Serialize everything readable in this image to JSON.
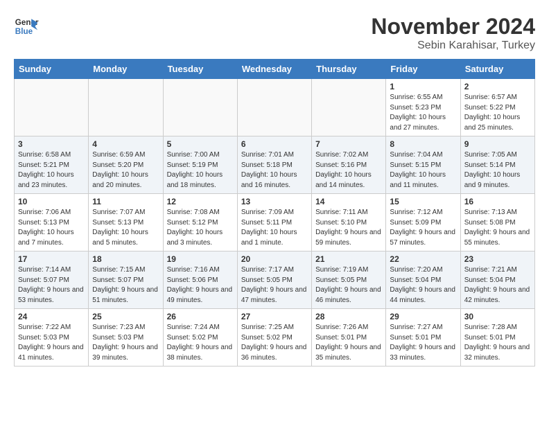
{
  "header": {
    "logo_text_general": "General",
    "logo_text_blue": "Blue",
    "month": "November 2024",
    "location": "Sebin Karahisar, Turkey"
  },
  "days_of_week": [
    "Sunday",
    "Monday",
    "Tuesday",
    "Wednesday",
    "Thursday",
    "Friday",
    "Saturday"
  ],
  "weeks": [
    [
      {
        "day": "",
        "info": ""
      },
      {
        "day": "",
        "info": ""
      },
      {
        "day": "",
        "info": ""
      },
      {
        "day": "",
        "info": ""
      },
      {
        "day": "",
        "info": ""
      },
      {
        "day": "1",
        "info": "Sunrise: 6:55 AM\nSunset: 5:23 PM\nDaylight: 10 hours and 27 minutes."
      },
      {
        "day": "2",
        "info": "Sunrise: 6:57 AM\nSunset: 5:22 PM\nDaylight: 10 hours and 25 minutes."
      }
    ],
    [
      {
        "day": "3",
        "info": "Sunrise: 6:58 AM\nSunset: 5:21 PM\nDaylight: 10 hours and 23 minutes."
      },
      {
        "day": "4",
        "info": "Sunrise: 6:59 AM\nSunset: 5:20 PM\nDaylight: 10 hours and 20 minutes."
      },
      {
        "day": "5",
        "info": "Sunrise: 7:00 AM\nSunset: 5:19 PM\nDaylight: 10 hours and 18 minutes."
      },
      {
        "day": "6",
        "info": "Sunrise: 7:01 AM\nSunset: 5:18 PM\nDaylight: 10 hours and 16 minutes."
      },
      {
        "day": "7",
        "info": "Sunrise: 7:02 AM\nSunset: 5:16 PM\nDaylight: 10 hours and 14 minutes."
      },
      {
        "day": "8",
        "info": "Sunrise: 7:04 AM\nSunset: 5:15 PM\nDaylight: 10 hours and 11 minutes."
      },
      {
        "day": "9",
        "info": "Sunrise: 7:05 AM\nSunset: 5:14 PM\nDaylight: 10 hours and 9 minutes."
      }
    ],
    [
      {
        "day": "10",
        "info": "Sunrise: 7:06 AM\nSunset: 5:13 PM\nDaylight: 10 hours and 7 minutes."
      },
      {
        "day": "11",
        "info": "Sunrise: 7:07 AM\nSunset: 5:13 PM\nDaylight: 10 hours and 5 minutes."
      },
      {
        "day": "12",
        "info": "Sunrise: 7:08 AM\nSunset: 5:12 PM\nDaylight: 10 hours and 3 minutes."
      },
      {
        "day": "13",
        "info": "Sunrise: 7:09 AM\nSunset: 5:11 PM\nDaylight: 10 hours and 1 minute."
      },
      {
        "day": "14",
        "info": "Sunrise: 7:11 AM\nSunset: 5:10 PM\nDaylight: 9 hours and 59 minutes."
      },
      {
        "day": "15",
        "info": "Sunrise: 7:12 AM\nSunset: 5:09 PM\nDaylight: 9 hours and 57 minutes."
      },
      {
        "day": "16",
        "info": "Sunrise: 7:13 AM\nSunset: 5:08 PM\nDaylight: 9 hours and 55 minutes."
      }
    ],
    [
      {
        "day": "17",
        "info": "Sunrise: 7:14 AM\nSunset: 5:07 PM\nDaylight: 9 hours and 53 minutes."
      },
      {
        "day": "18",
        "info": "Sunrise: 7:15 AM\nSunset: 5:07 PM\nDaylight: 9 hours and 51 minutes."
      },
      {
        "day": "19",
        "info": "Sunrise: 7:16 AM\nSunset: 5:06 PM\nDaylight: 9 hours and 49 minutes."
      },
      {
        "day": "20",
        "info": "Sunrise: 7:17 AM\nSunset: 5:05 PM\nDaylight: 9 hours and 47 minutes."
      },
      {
        "day": "21",
        "info": "Sunrise: 7:19 AM\nSunset: 5:05 PM\nDaylight: 9 hours and 46 minutes."
      },
      {
        "day": "22",
        "info": "Sunrise: 7:20 AM\nSunset: 5:04 PM\nDaylight: 9 hours and 44 minutes."
      },
      {
        "day": "23",
        "info": "Sunrise: 7:21 AM\nSunset: 5:04 PM\nDaylight: 9 hours and 42 minutes."
      }
    ],
    [
      {
        "day": "24",
        "info": "Sunrise: 7:22 AM\nSunset: 5:03 PM\nDaylight: 9 hours and 41 minutes."
      },
      {
        "day": "25",
        "info": "Sunrise: 7:23 AM\nSunset: 5:03 PM\nDaylight: 9 hours and 39 minutes."
      },
      {
        "day": "26",
        "info": "Sunrise: 7:24 AM\nSunset: 5:02 PM\nDaylight: 9 hours and 38 minutes."
      },
      {
        "day": "27",
        "info": "Sunrise: 7:25 AM\nSunset: 5:02 PM\nDaylight: 9 hours and 36 minutes."
      },
      {
        "day": "28",
        "info": "Sunrise: 7:26 AM\nSunset: 5:01 PM\nDaylight: 9 hours and 35 minutes."
      },
      {
        "day": "29",
        "info": "Sunrise: 7:27 AM\nSunset: 5:01 PM\nDaylight: 9 hours and 33 minutes."
      },
      {
        "day": "30",
        "info": "Sunrise: 7:28 AM\nSunset: 5:01 PM\nDaylight: 9 hours and 32 minutes."
      }
    ]
  ]
}
